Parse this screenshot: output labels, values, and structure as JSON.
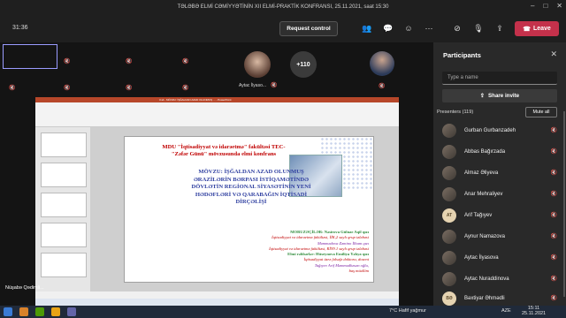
{
  "window": {
    "title": "TƏLƏBƏ ELMİ CƏMİYYƏTİNİN XII ELMİ-PRAKTİK KONFRANSI, 25.11.2021, saat 15:30"
  },
  "toolbar": {
    "timer": "31:36",
    "request_control": "Request control",
    "leave": "Leave"
  },
  "stage": {
    "plus_count": "+110",
    "tile_name": "Aytac İlyaso...",
    "self_name": "Nüşabə Qədimli..."
  },
  "slide": {
    "app_title": "3.sli - MÖVZU: İŞĞALDAN AZAD OLUNMUŞ ... - PowerPoint",
    "heading_lines": [
      "MDU \"İqtisadiyyat və idarəetmə\" fakültəsi TEC-",
      "\"Zəfər Günü\" mövzusunda elmi konfrans"
    ],
    "topic_lines": [
      "MÖVZU: İŞĞALDAN AZAD OLUNMUŞ",
      "ƏRAZİLƏRİN BƏRPASI İSTİQAMƏTİNDƏ",
      "DÖVLƏTİN REGİONAL SİYASƏTİNİN YENİ",
      "HƏDƏFLƏRİ VƏ QARABAĞIN İQTİSADİ",
      "DİRÇƏLİŞİ"
    ],
    "speakers_label": "MORUZƏÇİLƏR: Nəsirova Gülnar Aqil qızı",
    "speaker1_info": "İqtisadiyyat və idarəetmə fakültəsi, İİK,2 saylı qrup tələbəsi",
    "speaker2_name": "Məmmədova Zəmino İlham qızı",
    "speaker2_info": "İqtisadiyyat və idarəetmə fakültəsi, RİY9.1 saylı qrup tələbəsi",
    "supervisor_label": "Elmi rəhbərlər: Hüseynova Emiliya Yəhya qızı",
    "supervisor1_info": "İqtisadiyyat üzrə fəlsəfə doktoru, dosent",
    "supervisor2_name": "Tağıyev Arif Məmmədhəsən oğlu,",
    "supervisor2_info": "baş müəllim"
  },
  "panel": {
    "title": "Participants",
    "search_placeholder": "Type a name",
    "share_invite": "Share invite",
    "presenters_label": "Presenters (119)",
    "mute_all": "Mute all",
    "participants": [
      {
        "name": "Gurban Gurbanzadeh",
        "initials": ""
      },
      {
        "name": "Abbas Bağırzada",
        "initials": ""
      },
      {
        "name": "Almaz Əliyeva",
        "initials": ""
      },
      {
        "name": "Anar Mehraliyev",
        "initials": ""
      },
      {
        "name": "Arif Tağıyev",
        "initials": "AT"
      },
      {
        "name": "Aynur Namazova",
        "initials": ""
      },
      {
        "name": "Aytac İlyasova",
        "initials": ""
      },
      {
        "name": "Aytac Nuraddinova",
        "initials": ""
      },
      {
        "name": "Bəxtiyar Əhmədli",
        "initials": "BƏ"
      }
    ]
  },
  "taskbar": {
    "weather": "7°C  Hafif yağmur",
    "lang": "AZE",
    "time": "15:11",
    "date": "25.11.2021"
  },
  "colors": {
    "leave": "#c4314b",
    "slide_red": "#c00000",
    "slide_blue": "#2f3fa0",
    "slide_green": "#2e8b3a"
  }
}
